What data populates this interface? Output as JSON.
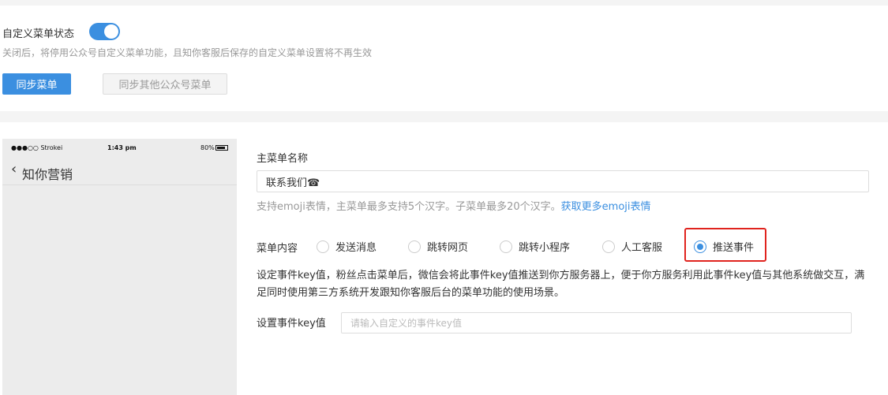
{
  "settings": {
    "status_label": "自定义菜单状态",
    "status_enabled": true,
    "status_desc": "关闭后，将停用公众号自定义菜单功能，且知你客服后保存的自定义菜单设置将不再生效",
    "sync_button": "同步菜单",
    "sync_other_button": "同步其他公众号菜单"
  },
  "phone": {
    "carrier": "●●●○○ Strokei",
    "time": "1:43 pm",
    "battery": "80%",
    "back_icon": "chevron-left-icon",
    "title": "知你营销"
  },
  "form": {
    "main_name_label": "主菜单名称",
    "main_name_value": "联系我们☎",
    "hint_text": "支持emoji表情，主菜单最多支持5个汉字。子菜单最多20个汉字。",
    "hint_link": "获取更多emoji表情",
    "menu_content_label": "菜单内容",
    "options": [
      {
        "label": "发送消息",
        "selected": false
      },
      {
        "label": "跳转网页",
        "selected": false
      },
      {
        "label": "跳转小程序",
        "selected": false
      },
      {
        "label": "人工客服",
        "selected": false
      },
      {
        "label": "推送事件",
        "selected": true
      }
    ],
    "description": "设定事件key值，粉丝点击菜单后，微信会将此事件key值推送到你方服务器上，便于你方服务利用此事件key值与其他系统做交互，满足同时使用第三方系统开发跟知你客服后台的菜单功能的使用场景。",
    "event_key_label": "设置事件key值",
    "event_key_placeholder": "请输入自定义的事件key值",
    "highlight_color": "#e0231e",
    "accent_color": "#3b8fe0"
  }
}
